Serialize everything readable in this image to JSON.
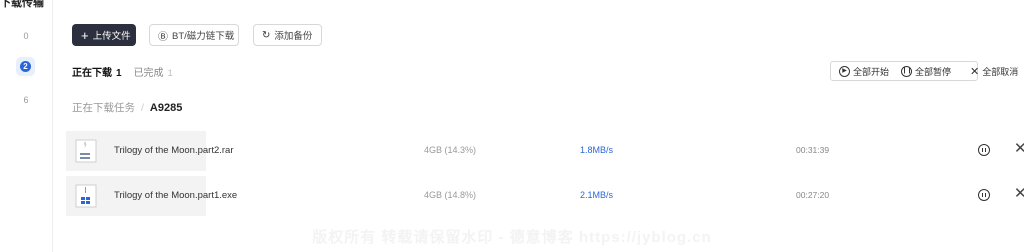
{
  "top_title": "下载传输",
  "sidebar": {
    "items": [
      {
        "count": "0"
      },
      {
        "count": "2"
      },
      {
        "count": "6"
      }
    ]
  },
  "toolbar": {
    "upload_label": "上传文件",
    "bt_label": "BT/磁力链下载",
    "backup_label": "添加备份"
  },
  "tabs": {
    "downloading_label": "正在下载",
    "downloading_count": "1",
    "completed_label": "已完成",
    "completed_count": "1"
  },
  "actions": {
    "start_all": "全部开始",
    "pause_all": "全部暂停",
    "cancel_all": "全部取消"
  },
  "breadcrumb": {
    "root": "正在下载任务",
    "separator": "/",
    "current": "A9285"
  },
  "tasks": [
    {
      "name": "Trilogy of the Moon.part2.rar",
      "size": "4GB (14.3%)",
      "speed": "1.8MB/s",
      "time": "00:31:39",
      "icon": "archive-file-icon"
    },
    {
      "name": "Trilogy of the Moon.part1.exe",
      "size": "4GB (14.8%)",
      "speed": "2.1MB/s",
      "time": "00:27:20",
      "icon": "exe-file-icon"
    }
  ],
  "watermark": "版权所有 转载请保留水印 - 德意博客 https://jyblog.cn",
  "colors": {
    "accent": "#2b66d9",
    "primary_button": "#2b2f3e"
  }
}
